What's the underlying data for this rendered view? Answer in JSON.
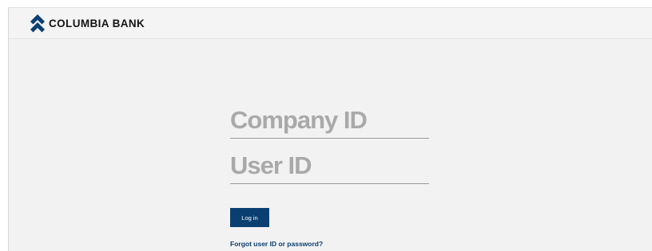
{
  "header": {
    "logo_text": "COLUMBIA BANK",
    "logo_icon": "chevron-up-double-icon",
    "brand_color": "#0a3f72"
  },
  "login_form": {
    "company_id_placeholder": "Company ID",
    "user_id_placeholder": "User ID",
    "login_button_label": "Log in",
    "forgot_link_label": "Forgot user ID or password?"
  },
  "colors": {
    "page_background": "#f2f2f2",
    "button_background": "#0a3f72",
    "link_color": "#0a3f72",
    "placeholder_color": "#a9a9a9"
  }
}
